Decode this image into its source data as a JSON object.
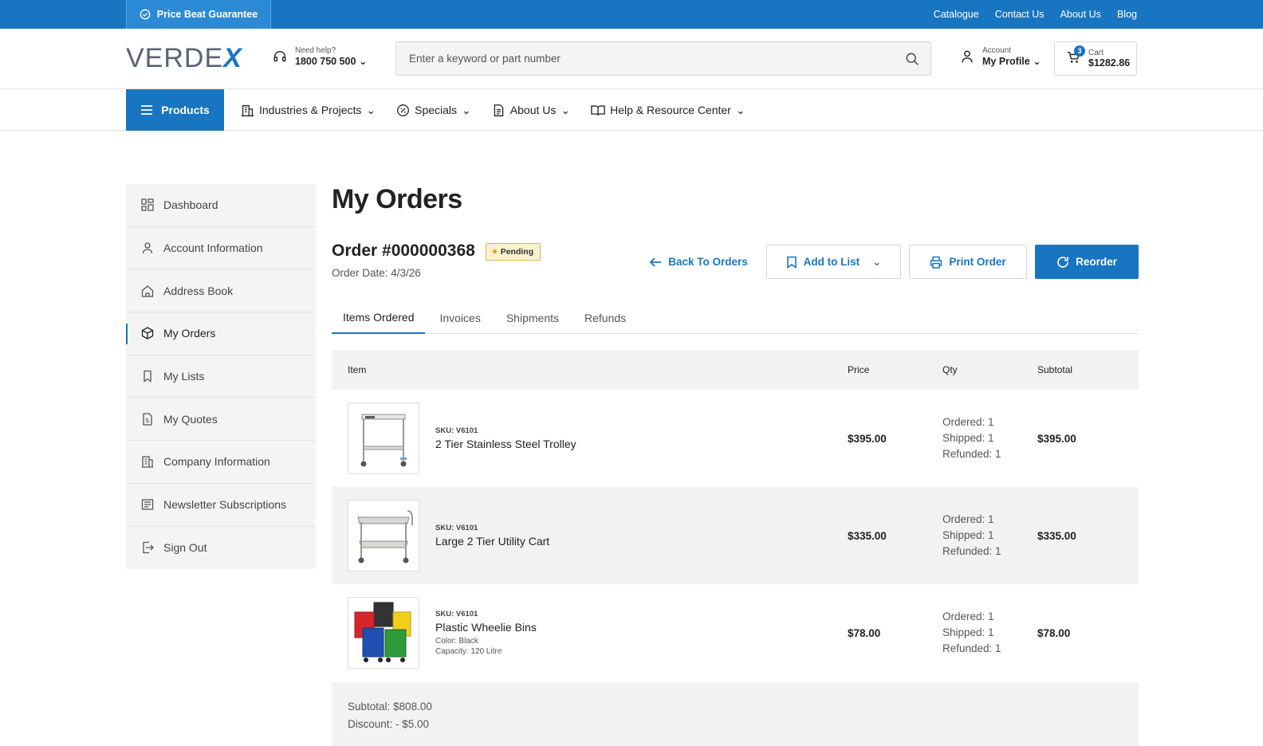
{
  "topbar": {
    "promo": "Price Beat Guarantee",
    "links": [
      "Catalogue",
      "Contact Us",
      "About Us",
      "Blog"
    ]
  },
  "header": {
    "logo_main": "VERDE",
    "logo_accent": "X",
    "help_label": "Need help?",
    "help_phone": "1800 750 500",
    "search_placeholder": "Enter a keyword or part number",
    "account_label": "Account",
    "account_value": "My Profile",
    "cart_label": "Cart",
    "cart_total": "$1282.86",
    "cart_count": "3"
  },
  "nav": {
    "products": "Products",
    "items": [
      "Industries & Projects",
      "Specials",
      "About Us",
      "Help & Resource Center"
    ]
  },
  "sidebar": {
    "items": [
      "Dashboard",
      "Account Information",
      "Address Book",
      "My Orders",
      "My Lists",
      "My Quotes",
      "Company Information",
      "Newsletter Subscriptions",
      "Sign Out"
    ]
  },
  "page": {
    "title": "My Orders",
    "order_number": "Order #000000368",
    "status": "Pending",
    "order_date": "Order Date: 4/3/26",
    "back": "Back To Orders",
    "add_to_list": "Add to List",
    "print": "Print Order",
    "reorder": "Reorder"
  },
  "tabs": [
    "Items Ordered",
    "Invoices",
    "Shipments",
    "Refunds"
  ],
  "table": {
    "headers": {
      "item": "Item",
      "price": "Price",
      "qty": "Qty",
      "subtotal": "Subtotal"
    },
    "rows": [
      {
        "sku": "SKU: V6101",
        "name": "2 Tier Stainless Steel Trolley",
        "options": [],
        "price": "$395.00",
        "ordered": "Ordered: 1",
        "shipped": "Shipped: 1",
        "refunded": "Refunded: 1",
        "subtotal": "$395.00"
      },
      {
        "sku": "SKU: V6101",
        "name": "Large 2 Tier Utility Cart",
        "options": [],
        "price": "$335.00",
        "ordered": "Ordered: 1",
        "shipped": "Shipped: 1",
        "refunded": "Refunded: 1",
        "subtotal": "$335.00"
      },
      {
        "sku": "SKU: V6101",
        "name": "Plastic Wheelie Bins",
        "options": [
          "Color: Black",
          "Capacity: 120 Litre"
        ],
        "price": "$78.00",
        "ordered": "Ordered: 1",
        "shipped": "Shipped: 1",
        "refunded": "Refunded: 1",
        "subtotal": "$78.00"
      }
    ]
  },
  "totals": {
    "subtotal": "Subtotal: $808.00",
    "discount": "Discount: - $5.00"
  },
  "colors": {
    "brand": "#1875c2",
    "pending_bg": "#fbf1cf",
    "pending_border": "#e2b44c"
  }
}
